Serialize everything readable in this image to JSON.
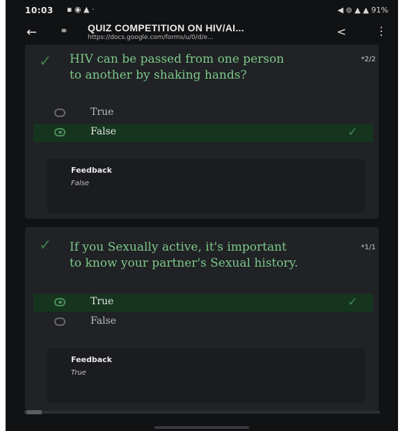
{
  "status_bar": {
    "time": "10:03",
    "left_icons": "▪ ◉ ▲ ·",
    "right_icons": "◀ ⊜ ▲ ▲ 91%"
  },
  "toolbar": {
    "title": "QUIZ COMPETITION ON HIV/AI...",
    "url": "https://docs.google.com/forms/u/0/d/e...",
    "back_icon": "arrow-left-icon",
    "lock_icon": "lock-icon",
    "share_icon": "share-icon",
    "menu_icon": "more-vert-icon"
  },
  "questions": [
    {
      "text": "HIV can be passed from one person to another by shaking hands?",
      "points": "*2/2",
      "options": [
        {
          "label": "True",
          "selected": false,
          "correct": false
        },
        {
          "label": "False",
          "selected": true,
          "correct": true
        }
      ],
      "feedback_title": "Feedback",
      "feedback_text": "False"
    },
    {
      "text": "If you Sexually active, it's important to know your partner's Sexual history.",
      "points": "*1/1",
      "options": [
        {
          "label": "True",
          "selected": true,
          "correct": true
        },
        {
          "label": "False",
          "selected": false,
          "correct": false
        }
      ],
      "feedback_title": "Feedback",
      "feedback_text": "True"
    }
  ],
  "colors": {
    "background": "#111214",
    "card": "#202225",
    "question_text": "#7dc98a",
    "selected_option": "#15351f",
    "check": "#3f8a4e"
  }
}
